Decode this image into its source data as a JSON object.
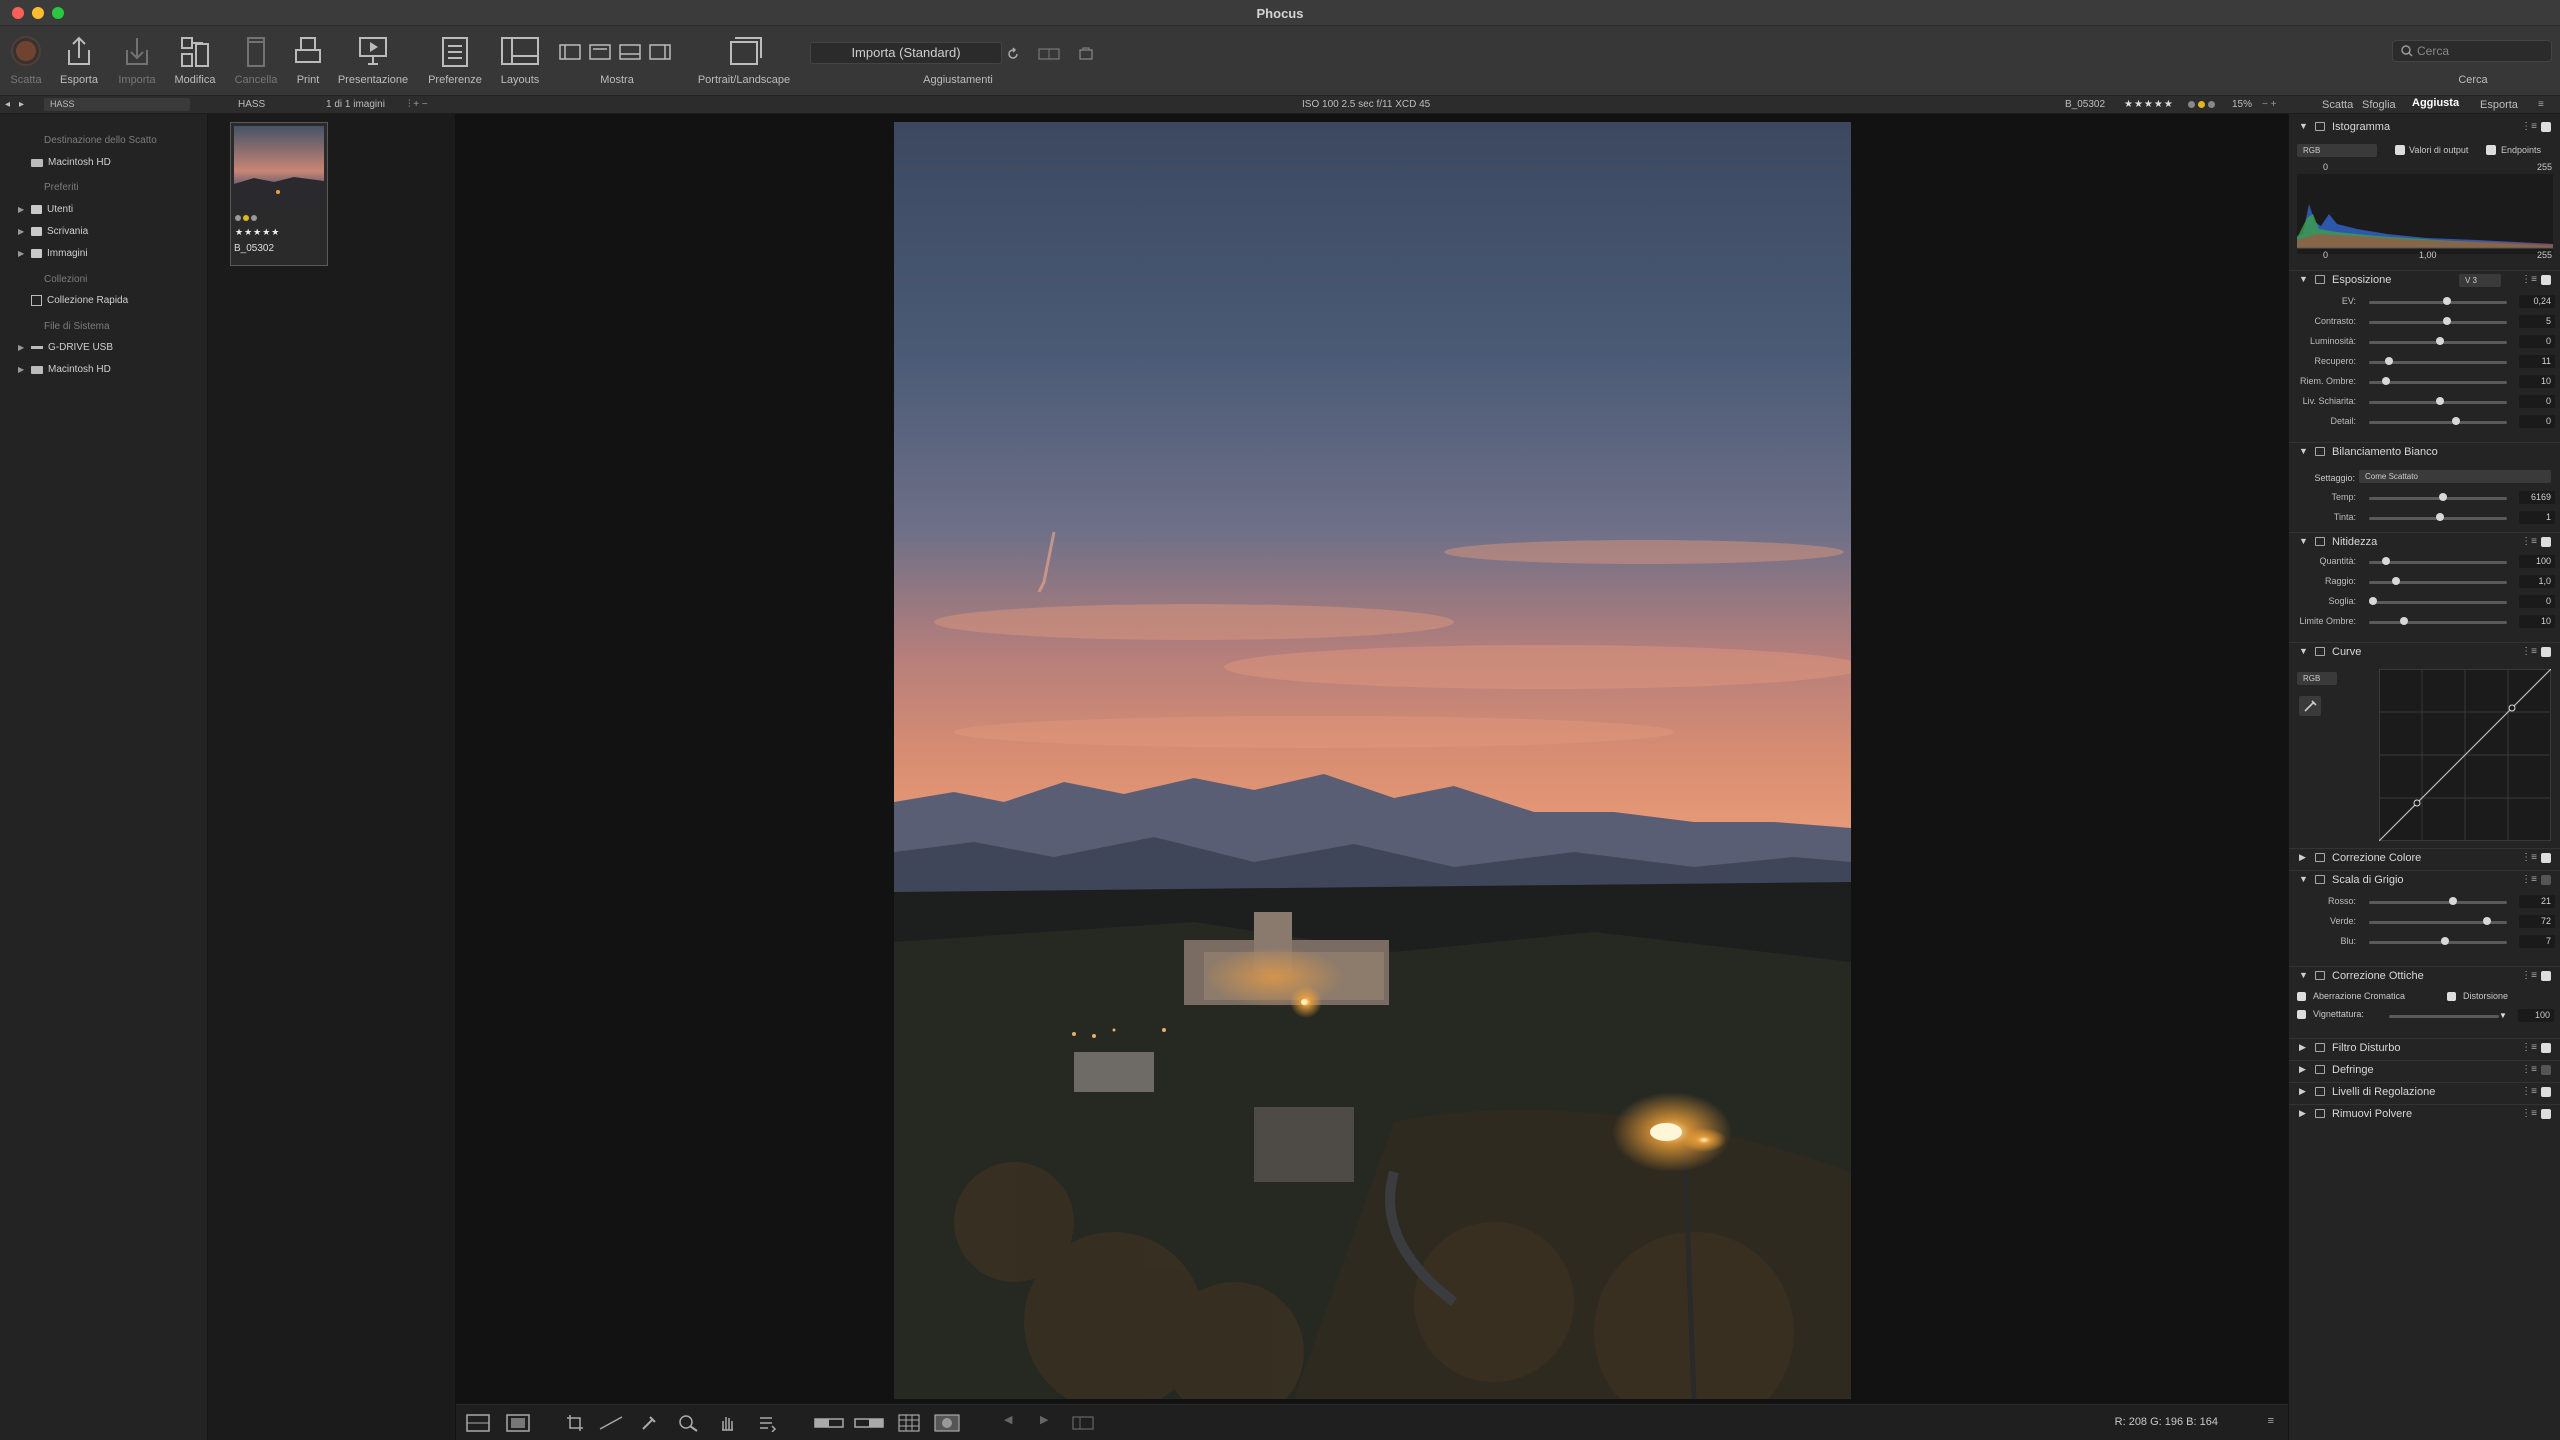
{
  "window": {
    "title": "Phocus"
  },
  "toolbar": {
    "items": [
      {
        "label": "Scatta",
        "icon": "capture-icon"
      },
      {
        "label": "Esporta",
        "icon": "export-icon"
      },
      {
        "label": "Importa",
        "icon": "import-icon"
      },
      {
        "label": "Modifica",
        "icon": "edit-icon"
      },
      {
        "label": "Cancella",
        "icon": "delete-icon"
      },
      {
        "label": "Print",
        "icon": "print-icon"
      },
      {
        "label": "Presentazione",
        "icon": "slideshow-icon"
      },
      {
        "label": "Preferenze",
        "icon": "preferences-icon"
      },
      {
        "label": "Layouts",
        "icon": "layouts-icon"
      },
      {
        "label": "Mostra",
        "icon": "view-mode-icon"
      },
      {
        "label": "Portrait/Landscape",
        "icon": "orientation-icon"
      },
      {
        "label": "Aggiustamenti",
        "icon": "adjustments-icon"
      },
      {
        "label": "Cerca",
        "icon": "search-icon"
      }
    ],
    "preset": "Importa (Standard)",
    "search_placeholder": "Cerca"
  },
  "subbar": {
    "location": "HASS",
    "folder": "HASS",
    "count": "1 di 1 imagini",
    "exif": "ISO 100  2.5 sec  f/11  XCD 45",
    "filename": "B_05302",
    "rating": "★★★★★",
    "zoom": "15%"
  },
  "left_panel": {
    "sections": [
      {
        "heading": "Destinazione dello Scatto",
        "items": [
          {
            "label": "Macintosh HD",
            "type": "disk",
            "expandable": false
          }
        ]
      },
      {
        "heading": "Preferiti",
        "items": [
          {
            "label": "Utenti",
            "type": "folder",
            "expandable": true
          },
          {
            "label": "Scrivania",
            "type": "folder",
            "expandable": true
          },
          {
            "label": "Immagini",
            "type": "folder",
            "expandable": true
          }
        ]
      },
      {
        "heading": "Collezioni",
        "items": [
          {
            "label": "Collezione Rapida",
            "type": "collection",
            "expandable": false
          }
        ]
      },
      {
        "heading": "File di Sistema",
        "items": [
          {
            "label": "G-DRIVE USB",
            "type": "disk",
            "expandable": true
          },
          {
            "label": "Macintosh HD",
            "type": "disk",
            "expandable": true
          }
        ]
      }
    ]
  },
  "thumbnail": {
    "name": "B_05302",
    "stars": "★★★★★"
  },
  "viewer": {
    "readout": "R: 208  G: 196  B: 164"
  },
  "right_panel": {
    "tabs": [
      "Scatta",
      "Sfoglia",
      "Aggiusta",
      "Esporta"
    ],
    "active_tab": "Aggiusta",
    "histogram": {
      "title": "Istogramma",
      "channel": "RGB",
      "output_values_label": "Valori di output",
      "endpoints_label": "Endpoints",
      "in_low": "0",
      "in_high": "255",
      "out_low": "0",
      "out_mid": "1,00",
      "out_high": "255"
    },
    "exposure": {
      "title": "Esposizione",
      "version": "V 3",
      "rows": [
        {
          "label": "EV:",
          "value": "0,24",
          "pos": 0.55
        },
        {
          "label": "Contrasto:",
          "value": "5",
          "pos": 0.55
        },
        {
          "label": "Luminosità:",
          "value": "0",
          "pos": 0.5
        },
        {
          "label": "Recupero:",
          "value": "11",
          "pos": 0.12
        },
        {
          "label": "Riem. Ombre:",
          "value": "10",
          "pos": 0.1
        },
        {
          "label": "Liv. Schiarita:",
          "value": "0",
          "pos": 0.5
        },
        {
          "label": "Detail:",
          "value": "0",
          "pos": 0.62
        }
      ]
    },
    "white_balance": {
      "title": "Bilanciamento Bianco",
      "setting_label": "Settaggio:",
      "setting_value": "Come Scattato",
      "rows": [
        {
          "label": "Temp:",
          "value": "6169",
          "pos": 0.52
        },
        {
          "label": "Tinta:",
          "value": "1",
          "pos": 0.5
        }
      ]
    },
    "sharpness": {
      "title": "Nitidezza",
      "rows": [
        {
          "label": "Quantità:",
          "value": "100",
          "pos": 0.1
        },
        {
          "label": "Raggio:",
          "value": "1,0",
          "pos": 0.17
        },
        {
          "label": "Soglia:",
          "value": "0",
          "pos": 0.0
        },
        {
          "label": "Limite Ombre:",
          "value": "10",
          "pos": 0.23
        }
      ]
    },
    "curves": {
      "title": "Curve",
      "channel": "RGB"
    },
    "collapsed_1": [
      {
        "title": "Correzione Colore"
      }
    ],
    "grayscale": {
      "title": "Scala di Grigio",
      "rows": [
        {
          "label": "Rosso:",
          "value": "21",
          "pos": 0.6
        },
        {
          "label": "Verde:",
          "value": "72",
          "pos": 0.85
        },
        {
          "label": "Blu:",
          "value": "7",
          "pos": 0.54
        }
      ]
    },
    "optics": {
      "title": "Correzione Ottiche",
      "chromatic_label": "Aberrazione Cromatica",
      "distortion_label": "Distorsione",
      "vignetting_label": "Vignettatura:",
      "vignetting_value": "100"
    },
    "collapsed_2": [
      {
        "title": "Filtro Disturbo"
      },
      {
        "title": "Defringe"
      },
      {
        "title": "Livelli di Regolazione"
      },
      {
        "title": "Rimuovi Polvere"
      }
    ]
  },
  "colors": {
    "bg": "#1a1a1a",
    "panel": "#242424",
    "toolbar": "#373737",
    "accent_red": "#c25730"
  }
}
